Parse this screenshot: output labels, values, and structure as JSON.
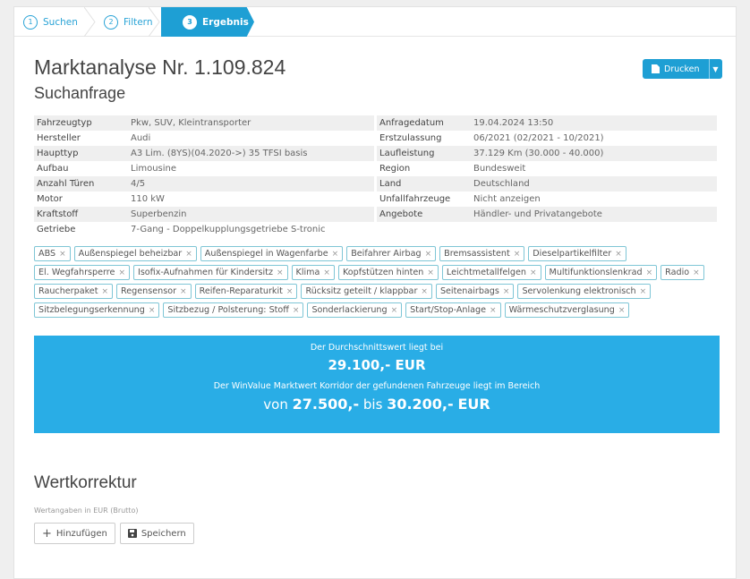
{
  "steps": [
    {
      "num": "1",
      "label": "Suchen"
    },
    {
      "num": "2",
      "label": "Filtern"
    },
    {
      "num": "3",
      "label": "Ergebnis"
    }
  ],
  "title": "Marktanalyse Nr. 1.109.824",
  "subtitle": "Suchanfrage",
  "print_button": {
    "label": "Drucken"
  },
  "left_table": [
    {
      "label": "Fahrzeugtyp",
      "value": "Pkw, SUV, Kleintransporter"
    },
    {
      "label": "Hersteller",
      "value": "Audi"
    },
    {
      "label": "Haupttyp",
      "value": "A3 Lim. (8YS)(04.2020->) 35 TFSI basis"
    },
    {
      "label": "Aufbau",
      "value": "Limousine"
    },
    {
      "label": "Anzahl Türen",
      "value": "4/5"
    },
    {
      "label": "Motor",
      "value": "110 kW"
    },
    {
      "label": "Kraftstoff",
      "value": "Superbenzin"
    },
    {
      "label": "Getriebe",
      "value": "7-Gang - Doppelkupplungsgetriebe S-tronic"
    }
  ],
  "right_table": [
    {
      "label": "Anfragedatum",
      "value": "19.04.2024 13:50"
    },
    {
      "label": "Erstzulassung",
      "value": "06/2021 (02/2021 - 10/2021)"
    },
    {
      "label": "Laufleistung",
      "value": "37.129 Km (30.000 - 40.000)"
    },
    {
      "label": "Region",
      "value": "Bundesweit"
    },
    {
      "label": "Land",
      "value": "Deutschland"
    },
    {
      "label": "Unfallfahrzeuge",
      "value": "Nicht anzeigen"
    },
    {
      "label": "Angebote",
      "value": "Händler- und Privatangebote"
    }
  ],
  "tags": [
    "ABS",
    "Außenspiegel beheizbar",
    "Außenspiegel in Wagenfarbe",
    "Beifahrer Airbag",
    "Bremsassistent",
    "Dieselpartikelfilter",
    "El. Wegfahrsperre",
    "Isofix-Aufnahmen für Kindersitz",
    "Klima",
    "Kopfstützen hinten",
    "Leichtmetallfelgen",
    "Multifunktionslenkrad",
    "Radio",
    "Raucherpaket",
    "Regensensor",
    "Reifen-Reparaturkit",
    "Rücksitz geteilt / klappbar",
    "Seitenairbags",
    "Servolenkung elektronisch",
    "Sitzbelegungserkennung",
    "Sitzbezug / Polsterung: Stoff",
    "Sonderlackierung",
    "Start/Stop-Anlage",
    "Wärmeschutzverglasung"
  ],
  "tag_remove": "×",
  "result": {
    "avg_label": "Der Durchschnittswert liegt bei",
    "avg_value": "29.100,- EUR",
    "corridor_label": "Der WinValue Marktwert Korridor der gefundenen Fahrzeuge liegt im Bereich",
    "from_word": "von",
    "from_value": "27.500,-",
    "to_word": "bis",
    "to_value": "30.200,-",
    "currency": "EUR"
  },
  "correction": {
    "title": "Wertkorrektur",
    "hint": "Wertangaben in EUR (Brutto)",
    "add_label": "Hinzufügen",
    "save_label": "Speichern"
  }
}
